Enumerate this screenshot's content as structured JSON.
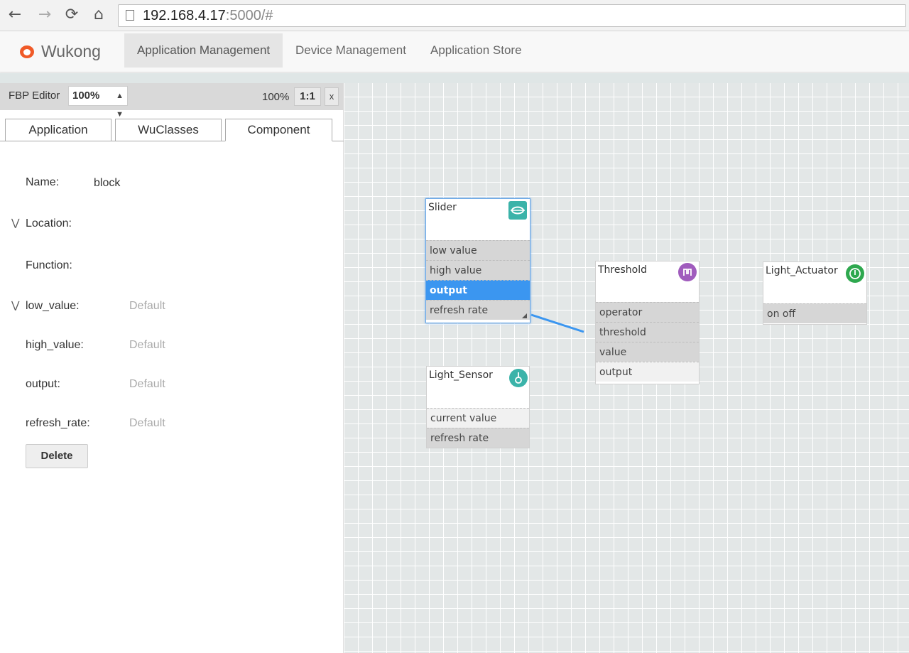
{
  "browser": {
    "back_icon": "arrow-left-icon",
    "forward_icon": "arrow-right-icon",
    "reload_icon": "reload-icon",
    "home_icon": "home-icon",
    "url_host": "192.168.4.17",
    "url_rest": ":5000/#"
  },
  "navbar": {
    "brand": "Wukong",
    "items": [
      "Application Management",
      "Device Management",
      "Application Store"
    ],
    "accent": "#f05a28"
  },
  "editor": {
    "label": "FBP Editor",
    "zoom": "100%",
    "zoom_readout": "100%",
    "ratio_label": "1:1",
    "close_label": "x"
  },
  "tabs": [
    "Application",
    "WuClasses",
    "Component"
  ],
  "properties": {
    "name_label": "Name:",
    "name_value": "block",
    "location_label": "Location:",
    "function_label": "Function:",
    "fields": [
      {
        "label": "low_value:",
        "value": "Default"
      },
      {
        "label": "high_value:",
        "value": "Default"
      },
      {
        "label": "output:",
        "value": "Default"
      },
      {
        "label": "refresh_rate:",
        "value": "Default"
      }
    ],
    "delete_label": "Delete"
  },
  "blocks": {
    "slider": {
      "title": "Slider",
      "icon": "slider-icon",
      "icon_color": "#3bb3a9",
      "ports": [
        "low value",
        "high value",
        "output",
        "refresh rate"
      ]
    },
    "threshold": {
      "title": "Threshold",
      "icon": "threshold-icon",
      "icon_color": "#a05bbd",
      "ports": [
        "operator",
        "threshold",
        "value",
        "output"
      ]
    },
    "light_actuator": {
      "title": "Light_Actuator",
      "icon": "light-actuator-icon",
      "icon_color": "#2ea84e",
      "ports": [
        "on off"
      ]
    },
    "light_sensor": {
      "title": "Light_Sensor",
      "icon": "light-sensor-icon",
      "icon_color": "#3bb3a9",
      "ports": [
        "current value",
        "refresh rate"
      ]
    }
  },
  "colors": {
    "selection": "#3b96f0",
    "link": "#3b96f0"
  }
}
